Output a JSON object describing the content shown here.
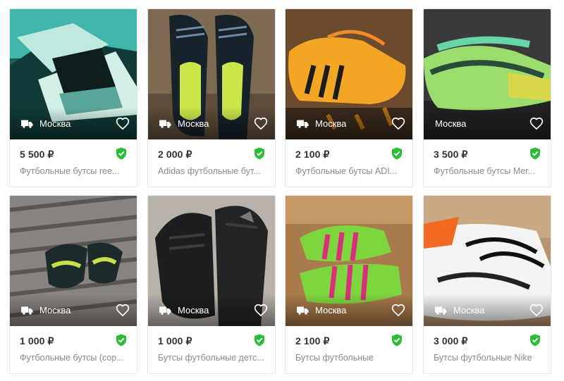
{
  "icons": {
    "location": "truck-icon",
    "favorite": "heart-outline-icon",
    "verified": "shield-check-icon"
  },
  "colors": {
    "verified_green": "#2dbb3a",
    "price_text": "#333333",
    "title_text": "#8a8a8a"
  },
  "listings": [
    {
      "city": "Москва",
      "price": "5 500 ₽",
      "title": "Футбольные бутсы ree..."
    },
    {
      "city": "Москва",
      "price": "2 000 ₽",
      "title": "Adidas футбольные бут..."
    },
    {
      "city": "Москва",
      "price": "2 100 ₽",
      "title": "Футбольные бутсы ADI..."
    },
    {
      "city": "Москва",
      "price": "3 500 ₽",
      "title": "Футбольные бутсы Mer..."
    },
    {
      "city": "Москва",
      "price": "1 000 ₽",
      "title": "Футбольные бутсы (сор..."
    },
    {
      "city": "Москва",
      "price": "1 000 ₽",
      "title": "Бутсы футбольные детс..."
    },
    {
      "city": "Москва",
      "price": "2 100 ₽",
      "title": "Бутсы футбольные"
    },
    {
      "city": "Москва",
      "price": "3 000 ₽",
      "title": "Бутсы футбольные Nike"
    }
  ]
}
